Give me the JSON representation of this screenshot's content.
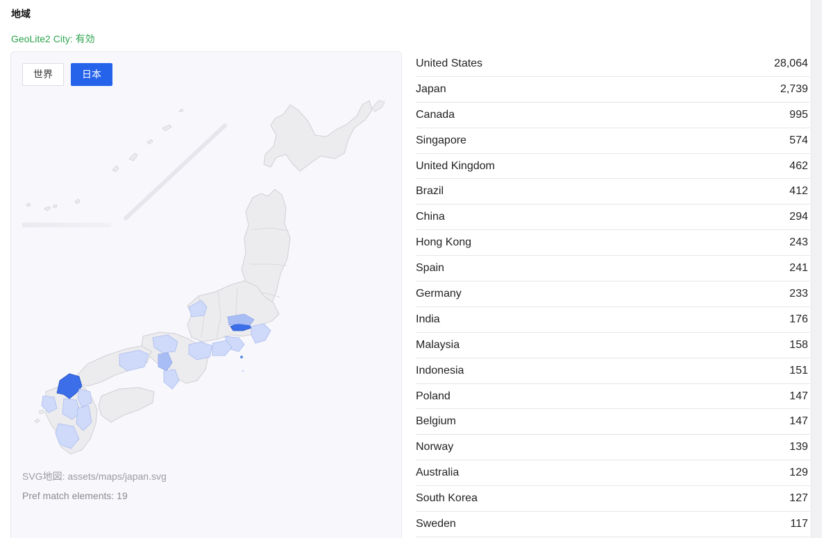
{
  "section": {
    "title": "地域"
  },
  "geo_status": "GeoLite2 City: 有効",
  "tabs": [
    {
      "label": "世界",
      "active": false
    },
    {
      "label": "日本",
      "active": true
    }
  ],
  "map": {
    "highlight_colors": {
      "strong": "#3b6ee8",
      "medium": "#a9bdf5",
      "light": "#cfdafa",
      "base": "#ececee"
    },
    "svg_note": "SVG地図: assets/maps/japan.svg",
    "match_note": "Pref match elements: 19"
  },
  "countries": [
    {
      "name": "United States",
      "count": "28,064"
    },
    {
      "name": "Japan",
      "count": "2,739"
    },
    {
      "name": "Canada",
      "count": "995"
    },
    {
      "name": "Singapore",
      "count": "574"
    },
    {
      "name": "United Kingdom",
      "count": "462"
    },
    {
      "name": "Brazil",
      "count": "412"
    },
    {
      "name": "China",
      "count": "294"
    },
    {
      "name": "Hong Kong",
      "count": "243"
    },
    {
      "name": "Spain",
      "count": "241"
    },
    {
      "name": "Germany",
      "count": "233"
    },
    {
      "name": "India",
      "count": "176"
    },
    {
      "name": "Malaysia",
      "count": "158"
    },
    {
      "name": "Indonesia",
      "count": "151"
    },
    {
      "name": "Poland",
      "count": "147"
    },
    {
      "name": "Belgium",
      "count": "147"
    },
    {
      "name": "Norway",
      "count": "139"
    },
    {
      "name": "Australia",
      "count": "129"
    },
    {
      "name": "South Korea",
      "count": "127"
    },
    {
      "name": "Sweden",
      "count": "117"
    }
  ]
}
